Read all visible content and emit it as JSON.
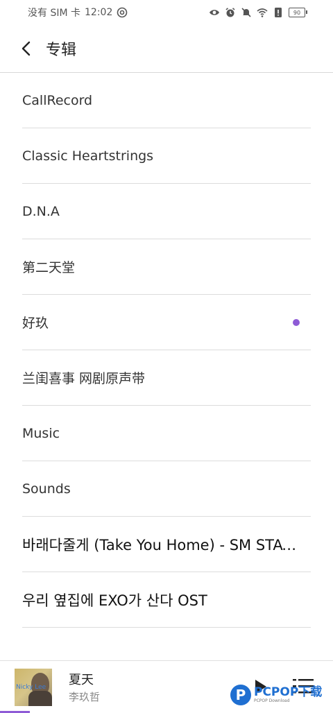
{
  "status_bar": {
    "carrier": "没有 SIM 卡",
    "time": "12:02",
    "battery": "90"
  },
  "header": {
    "title": "专辑"
  },
  "albums": [
    {
      "label": "CallRecord",
      "big": false,
      "playing": false
    },
    {
      "label": "Classic Heartstrings",
      "big": false,
      "playing": false
    },
    {
      "label": "D.N.A",
      "big": false,
      "playing": false
    },
    {
      "label": "第二天堂",
      "big": false,
      "playing": false
    },
    {
      "label": "好玖",
      "big": false,
      "playing": true
    },
    {
      "label": "兰闺喜事 网剧原声带",
      "big": false,
      "playing": false
    },
    {
      "label": "Music",
      "big": false,
      "playing": false
    },
    {
      "label": "Sounds",
      "big": false,
      "playing": false
    },
    {
      "label": "바래다줄게 (Take You Home) - SM STATI…",
      "big": true,
      "playing": false
    },
    {
      "label": "우리 옆집에 EXO가 산다 OST",
      "big": true,
      "playing": false
    }
  ],
  "player": {
    "title": "夏天",
    "artist": "李玖哲",
    "cover_text": "Nicky Lee",
    "progress": 0.09
  },
  "watermark": {
    "logo": "P",
    "main": "PCPOP下载",
    "sub": "PCPOP Download"
  },
  "colors": {
    "accent": "#8e5bd6",
    "divider": "#dcdcdc"
  }
}
